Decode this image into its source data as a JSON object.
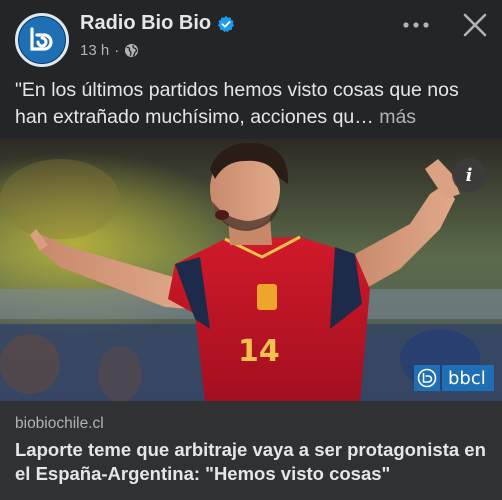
{
  "post": {
    "page_name": "Radio Bio Bio",
    "time": "13 h",
    "separator": "·",
    "text": "\"En los últimos partidos hemos visto cosas que nos han extrañado muchísimo, acciones qu…",
    "more_label": " más"
  },
  "icons": {
    "avatar": "biobio-logo",
    "verified": "verified-badge-icon",
    "audience": "globe-icon",
    "more": "more-options-icon",
    "close": "close-icon",
    "info": "info-icon"
  },
  "photo": {
    "info_label": "i",
    "watermark": "bbcl",
    "jersey_number": "14"
  },
  "link_card": {
    "domain": "biobiochile.cl",
    "title": "Laporte teme que arbitraje vaya a ser protagonista en el España-Argentina: \"Hemos visto cosas\""
  },
  "colors": {
    "background": "#242526",
    "card_background": "#303133",
    "brand_blue": "#1f6fb5",
    "verified_blue": "#1d9bf0",
    "jersey_red": "#c8102e"
  }
}
